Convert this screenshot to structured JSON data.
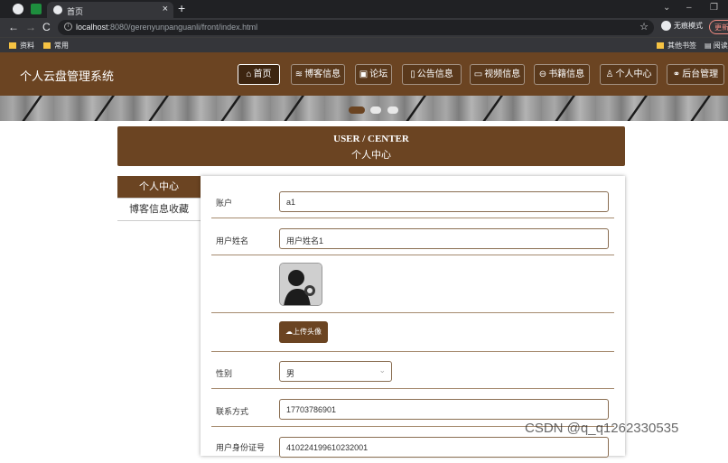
{
  "browser": {
    "tab_title": "首页",
    "url_host": "localhost",
    "url_rest": ":8080/gerenyunpanguanli/front/index.html",
    "incognito_label": "无痕模式",
    "update_label": "更新",
    "bookmarks": [
      "资料",
      "常用"
    ],
    "bookmarks_right": [
      "其他书签",
      "阅读"
    ]
  },
  "header": {
    "site_title": "个人云盘管理系统",
    "nav": [
      {
        "label": "首页",
        "icon": "home-icon"
      },
      {
        "label": "博客信息",
        "icon": "stack-icon"
      },
      {
        "label": "论坛",
        "icon": "forum-icon"
      },
      {
        "label": "公告信息",
        "icon": "book-icon"
      },
      {
        "label": "视频信息",
        "icon": "video-icon"
      },
      {
        "label": "书籍信息",
        "icon": "printer-icon"
      },
      {
        "label": "个人中心",
        "icon": "user-icon"
      },
      {
        "label": "后台管理",
        "icon": "link-icon"
      }
    ]
  },
  "user_center": {
    "title_en": "USER / CENTER",
    "title_cn": "个人中心",
    "side_menu": [
      "个人中心",
      "博客信息收藏"
    ]
  },
  "form": {
    "account_label": "账户",
    "account_value": "a1",
    "name_label": "用户姓名",
    "name_value": "用户姓名1",
    "upload_label": "上传头像",
    "gender_label": "性别",
    "gender_value": "男",
    "phone_label": "联系方式",
    "phone_value": "17703786901",
    "idcard_label": "用户身份证号",
    "idcard_value": "410224199610232001"
  },
  "watermark": "CSDN @q_q1262330535",
  "colors": {
    "brand": "#6b4422",
    "browser_dark": "#202124"
  }
}
